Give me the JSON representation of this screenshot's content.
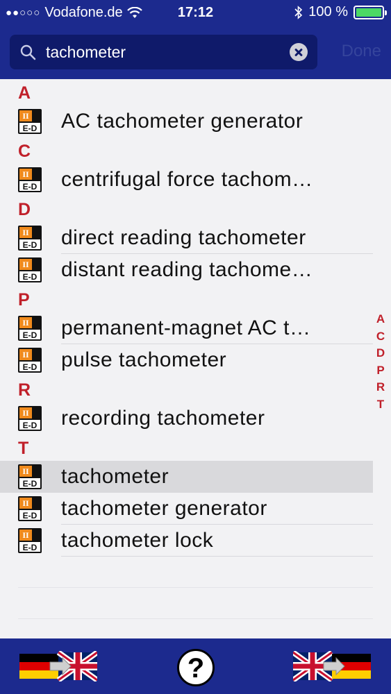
{
  "status_bar": {
    "carrier": "Vodafone.de",
    "signal_dots": "●●○○○",
    "time": "17:12",
    "battery_percent": "100 %",
    "battery_level": 1.0
  },
  "search": {
    "value": "tachometer",
    "done_label": "Done"
  },
  "colors": {
    "bar_blue": "#1c2a8e",
    "section_red": "#c0202a",
    "battery_green": "#4cd964"
  },
  "sections": [
    {
      "letter": "A",
      "items": [
        "AC tachometer generator"
      ]
    },
    {
      "letter": "C",
      "items": [
        "centrifugal force tachom…"
      ]
    },
    {
      "letter": "D",
      "items": [
        "direct reading tachometer",
        "distant reading tachome…"
      ]
    },
    {
      "letter": "P",
      "items": [
        "permanent-magnet AC t…",
        "pulse tachometer"
      ]
    },
    {
      "letter": "R",
      "items": [
        "recording tachometer"
      ]
    },
    {
      "letter": "T",
      "items": [
        "tachometer",
        "tachometer generator",
        "tachometer lock"
      ]
    }
  ],
  "index_letters": [
    "A",
    "C",
    "D",
    "P",
    "R",
    "T"
  ],
  "item_icon": {
    "name": "dictionary-e-d-icon",
    "top_text": "II",
    "bottom_text": "E-D"
  },
  "toolbar": {
    "left_icon": "german-to-english-flag-icon",
    "help_label": "?",
    "right_icon": "english-to-german-flag-icon"
  }
}
